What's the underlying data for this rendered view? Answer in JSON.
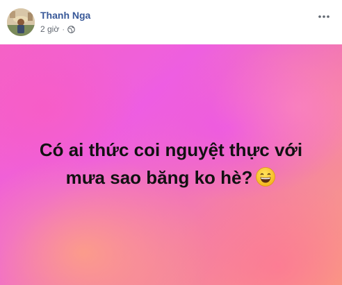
{
  "post": {
    "author": "Thanh Nga",
    "time": "2 giờ",
    "separator": "·",
    "privacy_icon": "globe-icon",
    "more_icon": "more-options-icon",
    "text_line1": "Có ai thức coi nguyệt thực với",
    "text_line2": "mưa sao băng ko hè?",
    "emoji": "grinning-face-emoji"
  },
  "colors": {
    "author_link": "#385898",
    "meta_text": "#616770",
    "bg_pink": "#f562c6",
    "bg_magenta": "#ee5fe0",
    "bg_orange": "#f9a07f",
    "text": "#111111"
  }
}
